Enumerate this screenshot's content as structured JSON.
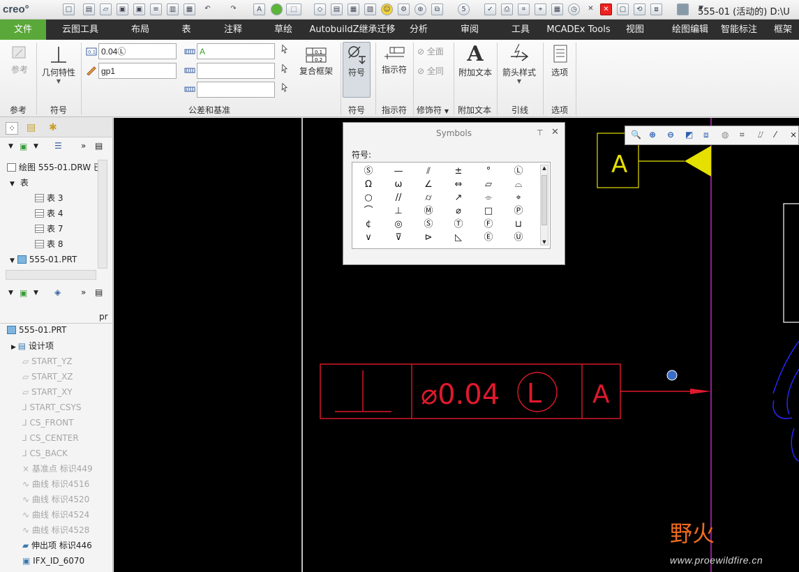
{
  "app": {
    "logo": "creo°",
    "window_title": "555-01 (活动的) D:\\U"
  },
  "menu": [
    {
      "label": "文件"
    },
    {
      "label": "云图工具"
    },
    {
      "label": "布局"
    },
    {
      "label": "表"
    },
    {
      "label": "注释"
    },
    {
      "label": "草绘"
    },
    {
      "label": "AutobuildZ继承迁移"
    },
    {
      "label": "分析"
    },
    {
      "label": "审阅"
    },
    {
      "label": "工具"
    },
    {
      "label": "MCADEx Tools"
    },
    {
      "label": "视图"
    },
    {
      "label": "绘图编辑"
    },
    {
      "label": "智能标注"
    },
    {
      "label": "框架"
    }
  ],
  "ribbon": {
    "ref_button": "参考",
    "ref_group": "参考",
    "geom_button": "几何特性",
    "symbol_group": "符号",
    "tol_value": "0.04Ⓛ",
    "tol_name": "gp1",
    "datum_1": "A",
    "datum_2": "",
    "datum_3": "",
    "tol_group": "公差和基准",
    "composite_button": "复合框架",
    "symbol_button": "符号",
    "symbol_group2": "符号",
    "indicator_button": "指示符",
    "indicator_group": "指示符",
    "all_on": "全面",
    "all_on2": "全同",
    "modifier_group": "修饰符",
    "addtext_button": "附加文本",
    "addtext_group": "附加文本",
    "arrow_button": "箭头样式",
    "leader_group": "引线",
    "options_button": "选项",
    "options_group": "选项"
  },
  "tree_top": {
    "drawing": "绘图 555-01.DRW 已",
    "tables_node": "表",
    "tables": [
      "表 3",
      "表 4",
      "表 7",
      "表 8"
    ],
    "part": "555-01.PRT"
  },
  "tree_bottom": {
    "col_header": "pr",
    "part": "555-01.PRT",
    "items": [
      {
        "label": "设计项",
        "dim": false
      },
      {
        "label": "START_YZ",
        "dim": true
      },
      {
        "label": "START_XZ",
        "dim": true
      },
      {
        "label": "START_XY",
        "dim": true
      },
      {
        "label": "START_CSYS",
        "dim": true
      },
      {
        "label": "CS_FRONT",
        "dim": true
      },
      {
        "label": "CS_CENTER",
        "dim": true
      },
      {
        "label": "CS_BACK",
        "dim": true
      },
      {
        "label": "基准点 标识449",
        "dim": true
      },
      {
        "label": "曲线 标识4516",
        "dim": true
      },
      {
        "label": "曲线 标识4520",
        "dim": true
      },
      {
        "label": "曲线 标识4524",
        "dim": true
      },
      {
        "label": "曲线 标识4528",
        "dim": true
      },
      {
        "label": "伸出项 标识446",
        "dim": false
      },
      {
        "label": "IFX_ID_6070",
        "dim": false
      }
    ]
  },
  "symbols_dialog": {
    "title": "Symbols",
    "label": "符号:",
    "symbols": [
      "Ⓢ",
      "—",
      "⫽",
      "±",
      "°",
      "Ⓛ",
      "Ω",
      "ω",
      "∠",
      "⇔",
      "▱",
      "⌓",
      "○",
      "//",
      "⌭",
      "↗",
      "⌯",
      "⌖",
      "⌒",
      "⊥",
      "Ⓜ",
      "⌀",
      "□",
      "Ⓟ",
      "¢",
      "◎",
      "Ⓢ",
      "Ⓣ",
      "Ⓕ",
      "⊔",
      "∨",
      "⊽",
      "⊳",
      "◺",
      "Ⓔ",
      "Ⓤ"
    ]
  },
  "drawing": {
    "datum_label": "A",
    "frame_symbol": "⊥",
    "frame_value": "⌀0.04",
    "frame_modifier": "L",
    "frame_datum": "A",
    "colors": {
      "red": "#e0192c",
      "yellow": "#e5e000",
      "magenta": "#c228c2",
      "blue": "#2727ff",
      "white": "#ffffff"
    }
  },
  "watermark": {
    "text": "野火",
    "url": "www.proewildfire.cn"
  }
}
